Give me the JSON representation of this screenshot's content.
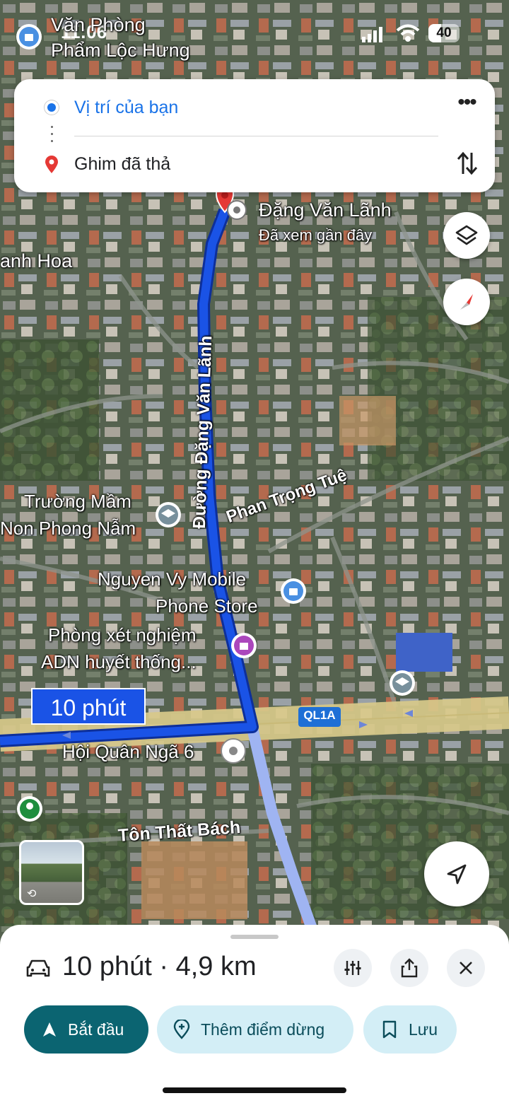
{
  "status_bar": {
    "time": "11:06",
    "battery": "40"
  },
  "top_label": {
    "line1": "Văn Phòng",
    "line2": "Phẩm Lộc Hưng"
  },
  "route_card": {
    "origin": "Vị trí của bạn",
    "destination": "Ghim đã thả"
  },
  "map": {
    "destination_title": "Đặng Văn Lãnh",
    "destination_subtitle": "Đã xem gần đây",
    "labels": {
      "anh_hoa": "anh Hoa",
      "street_dang_van_lanh": "Đường Đặng Văn Lãnh",
      "school_line1": "Trường Mầm",
      "school_line2": "Non Phong Nẫm",
      "phan_trong_tue": "Phan Trọng Tuệ",
      "store_line1": "Nguyen Vy Mobile",
      "store_line2": "Phone Store",
      "lab_line1": "Phòng xét nghiệm",
      "lab_line2": "ADN huyết thống...",
      "hoi_quan": "Hội Quân Ngã 6",
      "ton_that_bach": "Tôn Thất Bách",
      "highway": "QL1A"
    },
    "duration_badge": "10 phút"
  },
  "bottom_sheet": {
    "summary_time": "10 phút",
    "separator": "·",
    "summary_distance": "4,9 km",
    "start_label": "Bắt đầu",
    "add_stop_label": "Thêm điểm dừng",
    "save_label": "Lưu"
  },
  "colors": {
    "route": "#1a53e6",
    "route_alt": "#9fb4f2",
    "start_button": "#0b6471",
    "chip_bg": "#d3eef6",
    "chip_text": "#0a4c5a"
  }
}
